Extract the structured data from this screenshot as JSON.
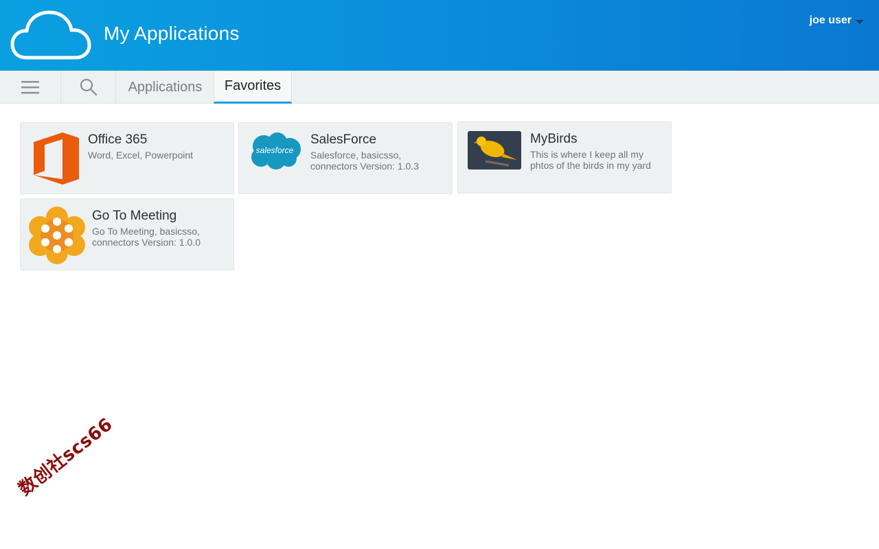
{
  "header": {
    "title": "My Applications",
    "logo_icon": "cloud-icon",
    "user_label": "joe user",
    "colors": {
      "gradient_start": "#0aa0e0",
      "gradient_end": "#0a78d2"
    }
  },
  "toolbar": {
    "menu_icon": "hamburger-icon",
    "search_icon": "search-icon",
    "tabs": [
      {
        "label": "Applications",
        "active": false
      },
      {
        "label": "Favorites",
        "active": true
      }
    ],
    "active_tab_color": "#1aa0e0"
  },
  "apps": [
    {
      "title": "Office 365",
      "description": "Word, Excel, Powerpoint",
      "icon": "office-365-icon"
    },
    {
      "title": "SalesForce",
      "description": "Salesforce, basicsso, connectors Version: 1.0.3",
      "icon": "salesforce-icon",
      "icon_text": "salesforce"
    },
    {
      "title": "MyBirds",
      "description": "This is where I keep all my phtos of the birds in my yard",
      "icon": "bird-photo-icon"
    },
    {
      "title": "Go To Meeting",
      "description": "Go To Meeting, basicsso, connectors Version: 1.0.0",
      "icon": "gotomeeting-icon"
    }
  ],
  "watermark": "数创社scs66"
}
